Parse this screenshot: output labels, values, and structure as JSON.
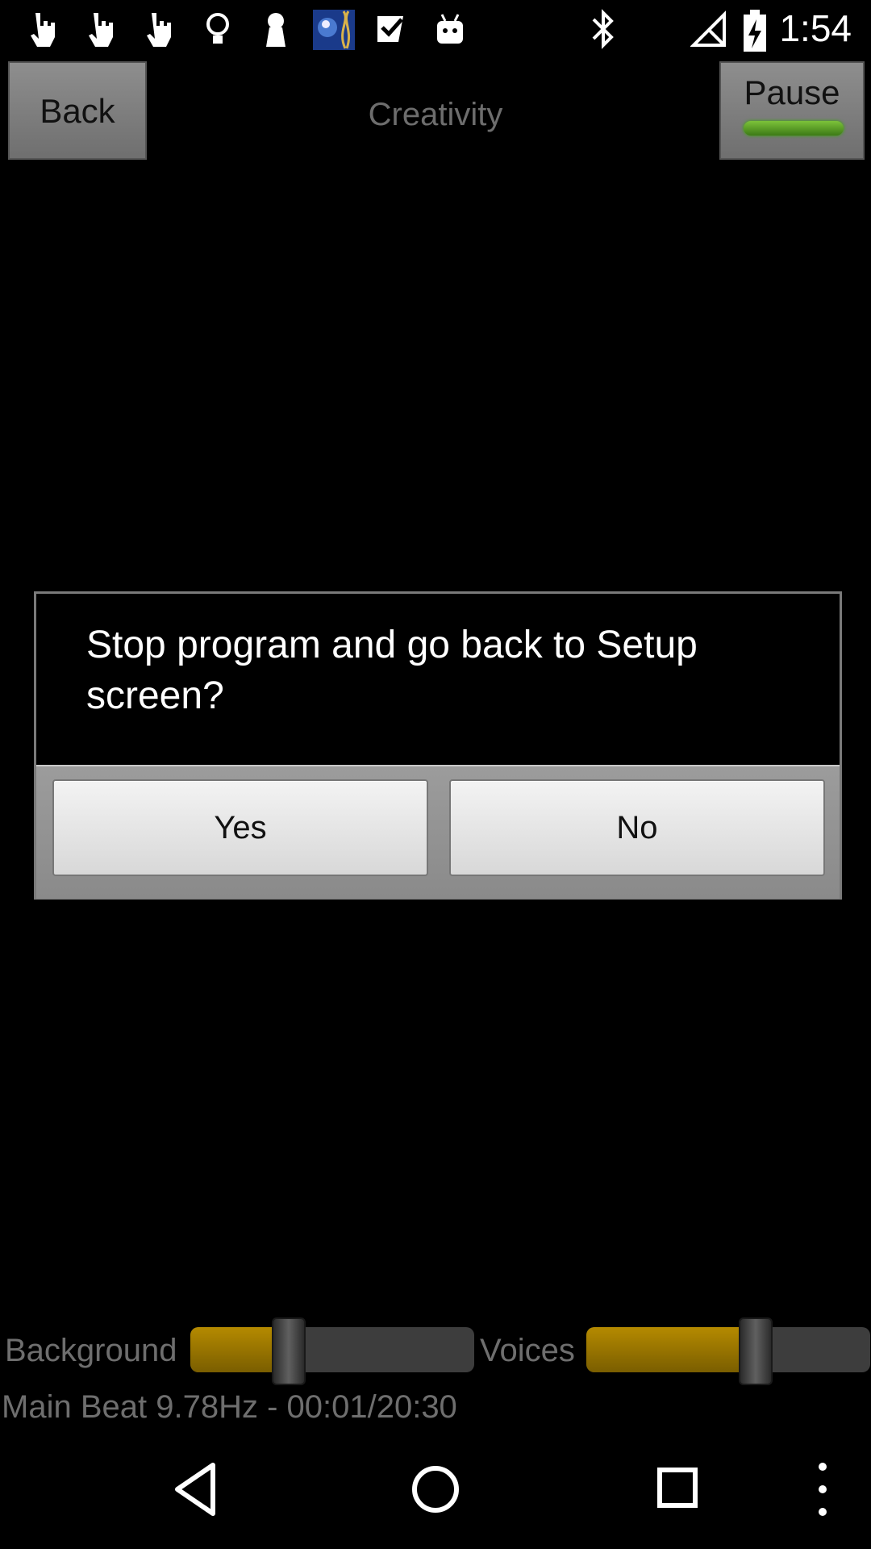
{
  "status_bar": {
    "time": "1:54",
    "left_icons": [
      "hand-tap-icon",
      "hand-tap-icon",
      "hand-tap-icon",
      "lightbulb-icon",
      "keyhole-icon",
      "brain-dna-icon",
      "check-flag-icon",
      "android-robot-icon"
    ],
    "right_icons": [
      "bluetooth-icon",
      "no-signal-icon",
      "battery-charging-icon"
    ]
  },
  "header": {
    "back_label": "Back",
    "title": "Creativity",
    "pause_label": "Pause",
    "pause_indicator_color": "#5aa428"
  },
  "dialog": {
    "message": "Stop program and go back to Setup screen?",
    "yes_label": "Yes",
    "no_label": "No"
  },
  "mixer": {
    "background_label": "Background",
    "background_level": 0.34,
    "voices_label": "Voices",
    "voices_level": 0.59,
    "accent_color": "#a07a00"
  },
  "footer": {
    "main_beat": "Main Beat 9.78Hz - 00:01/20:30"
  },
  "nav": {
    "buttons": [
      "back-triangle-icon",
      "home-circle-icon",
      "recents-square-icon",
      "overflow-dots-icon"
    ]
  }
}
